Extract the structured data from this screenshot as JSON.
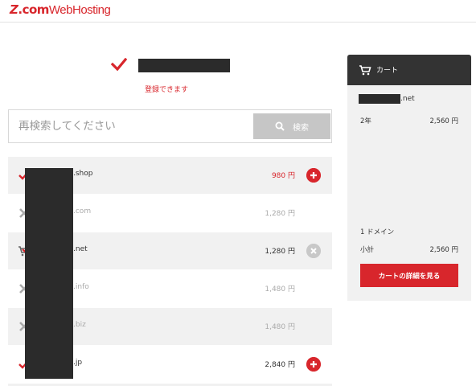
{
  "header": {
    "logo_z": "Z",
    "logo_dotcom": ".com",
    "logo_web": "WebHosting"
  },
  "status": {
    "message": "登録できます",
    "icon": "checkmark-icon",
    "color": "#d8262c"
  },
  "search": {
    "placeholder": "再検索してください",
    "value": "",
    "button_label": "検索",
    "button_icon": "search-icon"
  },
  "results": [
    {
      "name": ".shop",
      "price": "980 円",
      "status": "available",
      "status_icon": "checkmark-icon",
      "action": "add"
    },
    {
      "name": ".com",
      "price": "1,280 円",
      "status": "unavailable",
      "status_icon": "cross-icon",
      "action": "none"
    },
    {
      "name": ".net",
      "price": "1,280 円",
      "status": "in-cart",
      "status_icon": "cart-check-icon",
      "action": "remove"
    },
    {
      "name": ".info",
      "price": "1,480 円",
      "status": "unavailable",
      "status_icon": "cross-icon",
      "action": "none"
    },
    {
      "name": ".biz",
      "price": "1,480 円",
      "status": "unavailable",
      "status_icon": "cross-icon",
      "action": "none"
    },
    {
      "name": ".jp",
      "price": "2,840 円",
      "status": "available",
      "status_icon": "checkmark-icon",
      "action": "add"
    }
  ],
  "cart": {
    "title": "カート",
    "icon": "cart-icon",
    "domain": ".net",
    "term": "2年",
    "term_price": "2,560 円",
    "count": "1 ドメイン",
    "subtotal_label": "小計",
    "subtotal": "2,560 円",
    "button_label": "カートの詳細を見る"
  },
  "colors": {
    "accent": "#d8262c",
    "dark": "#333333",
    "row_shade": "#f1f1f1",
    "disabled": "#c6c6c6"
  }
}
